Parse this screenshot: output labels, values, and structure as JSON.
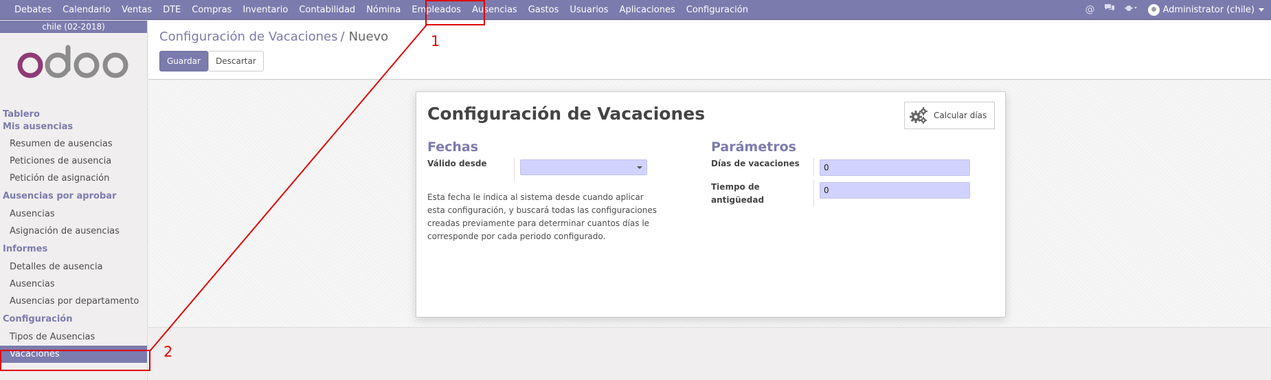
{
  "topbar": {
    "menu": [
      "Debates",
      "Calendario",
      "Ventas",
      "DTE",
      "Compras",
      "Inventario",
      "Contabilidad",
      "Nómina",
      "Empleados",
      "Ausencias",
      "Gastos",
      "Usuarios",
      "Aplicaciones",
      "Configuración"
    ],
    "icons": [
      "at-icon",
      "chat-icon",
      "bug-icon"
    ],
    "user": "Administrator (chile)"
  },
  "sidebar": {
    "company": "chile (02-2018)",
    "logo_text": "odoo",
    "sections": [
      {
        "title": "Tablero",
        "items": []
      },
      {
        "title": "Mis ausencias",
        "items": [
          "Resumen de ausencias",
          "Peticiones de ausencia",
          "Petición de asignación"
        ]
      },
      {
        "title": "Ausencias por aprobar",
        "items": [
          "Ausencias",
          "Asignación de ausencias"
        ]
      },
      {
        "title": "Informes",
        "items": [
          "Detalles de ausencia",
          "Ausencias",
          "Ausencias por departamento"
        ]
      },
      {
        "title": "Configuración",
        "items": [
          "Tipos de Ausencias",
          "Vacaciones"
        ]
      }
    ],
    "active_item": "Vacaciones"
  },
  "control": {
    "breadcrumb_parent": "Configuración de Vacaciones",
    "breadcrumb_sep": "/",
    "breadcrumb_current": "Nuevo",
    "save_label": "Guardar",
    "discard_label": "Descartar"
  },
  "form": {
    "title": "Configuración de Vacaciones",
    "stat_button": "Calcular días",
    "fechas_title": "Fechas",
    "valido_desde_label": "Válido desde",
    "valido_desde_value": "",
    "help_text": "Esta fecha le indica al sistema desde cuando aplicar esta configuración, y buscará todas las configuraciones creadas previamente para determinar cuantos días le corresponde por cada periodo configurado.",
    "parametros_title": "Parámetros",
    "dias_label": "Días de vacaciones",
    "dias_value": "0",
    "tiempo_label": "Tiempo de antigüedad",
    "tiempo_value": "0"
  },
  "annotations": {
    "color": "#e00000",
    "label_1": "1",
    "label_2": "2"
  },
  "colors": {
    "brand": "#7c7bad",
    "input_bg": "#d2d2ff"
  }
}
